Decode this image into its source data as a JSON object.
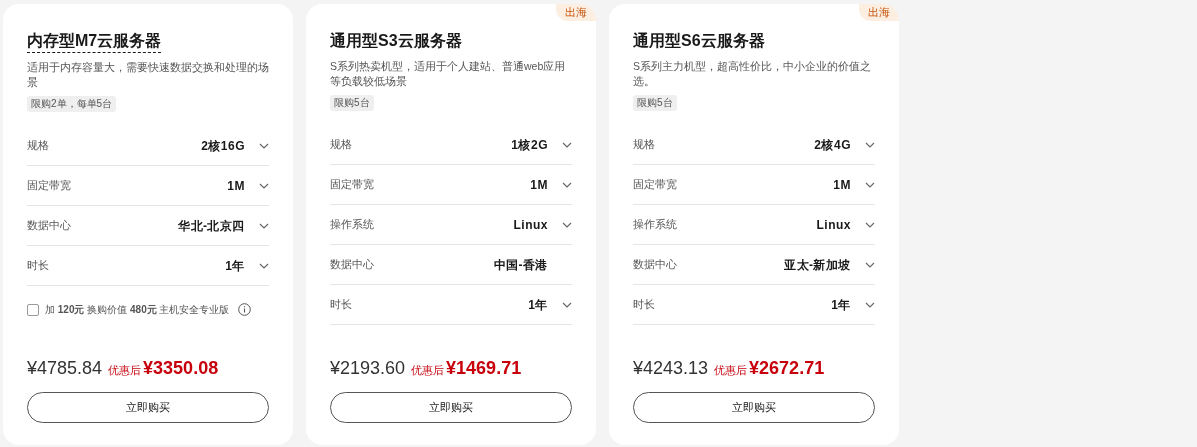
{
  "cards": [
    {
      "title": "内存型M7云服务器",
      "title_underlined": true,
      "description": "适用于内存容量大，需要快速数据交换和处理的场景",
      "limit_tag": "限购2单，每单5台",
      "options": [
        {
          "label": "规格",
          "value": "2核16G",
          "dropdown": true
        },
        {
          "label": "固定带宽",
          "value": "1M",
          "dropdown": true
        },
        {
          "label": "数据中心",
          "value": "华北-北京四",
          "dropdown": true
        },
        {
          "label": "时长",
          "value": "1年",
          "dropdown": true
        }
      ],
      "addon": {
        "checked": false,
        "text": "加 **120元** 换购价值 **480元** 主机安全专业版"
      },
      "original_price": "¥4785.84",
      "discount_label": "优惠后",
      "final_price": "¥3350.08",
      "buy_button": "立即购买"
    },
    {
      "badge": "出海",
      "title": "通用型S3云服务器",
      "title_underlined": false,
      "description": "S系列热卖机型，适用于个人建站、普通web应用等负载较低场景",
      "limit_tag": "限购5台",
      "options": [
        {
          "label": "规格",
          "value": "1核2G",
          "dropdown": true
        },
        {
          "label": "固定带宽",
          "value": "1M",
          "dropdown": true
        },
        {
          "label": "操作系统",
          "value": "Linux",
          "dropdown": true
        },
        {
          "label": "数据中心",
          "value": "中国-香港",
          "dropdown": false
        },
        {
          "label": "时长",
          "value": "1年",
          "dropdown": true
        }
      ],
      "original_price": "¥2193.60",
      "discount_label": "优惠后",
      "final_price": "¥1469.71",
      "buy_button": "立即购买"
    },
    {
      "badge": "出海",
      "title": "通用型S6云服务器",
      "title_underlined": false,
      "description": "S系列主力机型，超高性价比，中小企业的价值之选。",
      "limit_tag": "限购5台",
      "options": [
        {
          "label": "规格",
          "value": "2核4G",
          "dropdown": true
        },
        {
          "label": "固定带宽",
          "value": "1M",
          "dropdown": true
        },
        {
          "label": "操作系统",
          "value": "Linux",
          "dropdown": true
        },
        {
          "label": "数据中心",
          "value": "亚太-新加坡",
          "dropdown": true
        },
        {
          "label": "时长",
          "value": "1年",
          "dropdown": true
        }
      ],
      "original_price": "¥4243.13",
      "discount_label": "优惠后",
      "final_price": "¥2672.71",
      "buy_button": "立即购买"
    }
  ]
}
